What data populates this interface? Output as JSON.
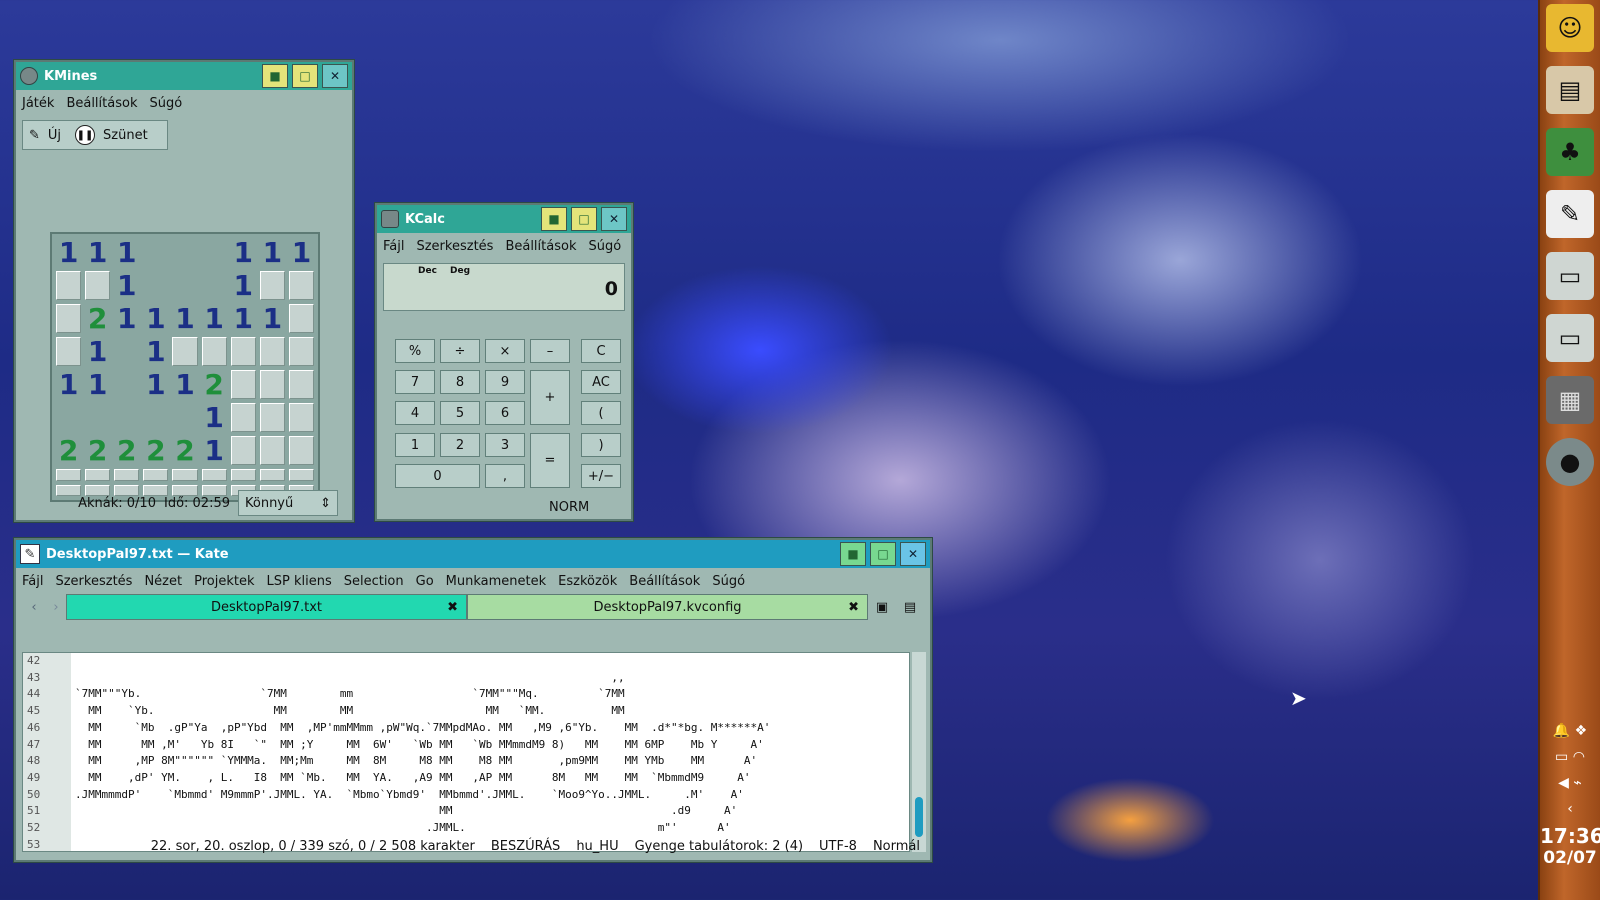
{
  "kmines": {
    "title": "KMines",
    "menu": [
      "Játék",
      "Beállítások",
      "Súgó"
    ],
    "new_label": "Új",
    "pause_label": "Szünet",
    "grid": [
      [
        "1",
        "1",
        "1",
        "",
        "",
        "",
        "1",
        "1",
        "1"
      ],
      [
        "#",
        "#",
        "1",
        "",
        "",
        "",
        "1",
        "#",
        "#"
      ],
      [
        "#",
        "2",
        "1",
        "1",
        "1",
        "1",
        "1",
        "1",
        "#"
      ],
      [
        "#",
        "1",
        "",
        "1",
        "#",
        "#",
        "#",
        "#",
        "#"
      ],
      [
        "1",
        "1",
        "",
        "1",
        "1",
        "2",
        "#",
        "#",
        "#"
      ],
      [
        "",
        "",
        "",
        "",
        "",
        "1",
        "#",
        "#",
        "#"
      ],
      [
        "2",
        "2",
        "2",
        "2",
        "2",
        "1",
        "#",
        "#",
        "#"
      ],
      [
        "#",
        "#",
        "#",
        "#",
        "#",
        "#",
        "#",
        "#",
        "#"
      ],
      [
        "#",
        "#",
        "#",
        "#",
        "#",
        "#",
        "#",
        "#",
        "#"
      ]
    ],
    "mines": "Aknák: 0/10",
    "time": "Idő: 02:59",
    "difficulty": "Könnyű"
  },
  "kcalc": {
    "title": "KCalc",
    "menu": [
      "Fájl",
      "Szerkesztés",
      "Beállítások",
      "Súgó"
    ],
    "dec": "Dec",
    "deg": "Deg",
    "display": "0",
    "mode": "NORM",
    "keys": {
      "pct": "%",
      "div": "÷",
      "mul": "×",
      "sub": "–",
      "clr": "C",
      "k7": "7",
      "k8": "8",
      "k9": "9",
      "add": "+",
      "ac": "AC",
      "k4": "4",
      "k5": "5",
      "k6": "6",
      "lp": "(",
      "k1": "1",
      "k2": "2",
      "k3": "3",
      "eq": "=",
      "rp": ")",
      "k0": "0",
      "dot": ",",
      "neg": "+/−"
    }
  },
  "kate": {
    "title": "DesktopPal97.txt — Kate",
    "menu": [
      "Fájl",
      "Szerkesztés",
      "Nézet",
      "Projektek",
      "LSP kliens",
      "Selection",
      "Go",
      "Munkamenetek",
      "Eszközök",
      "Beállítások",
      "Súgó"
    ],
    "tabs": [
      "DesktopPal97.txt",
      "DesktopPal97.kvconfig"
    ],
    "lines": [
      "42",
      "43",
      "44",
      "45",
      "46",
      "47",
      "48",
      "49",
      "50",
      "51",
      "52",
      "53"
    ],
    "code": [
      "",
      "                                                                                 ,,",
      "`7MM\"\"\"Yb.                  `7MM        mm                  `7MM\"\"\"Mq.         `7MM",
      "  MM    `Yb.                  MM        MM                    MM   `MM.          MM",
      "  MM     `Mb  .gP\"Ya  ,pP\"Ybd  MM  ,MP'mmMMmm ,pW\"Wq.`7MMpdMAo. MM   ,M9 ,6\"Yb.    MM  .d*\"*bg. M******A'",
      "  MM      MM ,M'   Yb 8I   `\"  MM ;Y     MM  6W'   `Wb MM   `Wb MMmmdM9 8)   MM    MM 6MP    Mb Y     A'",
      "  MM     ,MP 8M\"\"\"\"\"\" `YMMMa.  MM;Mm     MM  8M     M8 MM    M8 MM       ,pm9MM    MM YMb    MM      A'",
      "  MM    ,dP' YM.    , L.   I8  MM `Mb.   MM  YA.   ,A9 MM   ,AP MM      8M   MM    MM  `MbmmdM9     A'",
      ".JMMmmmdP'    `Mbmmd' M9mmmP'.JMML. YA.  `Mbmo`Ybmd9'  MMbmmd'.JMML.    `Moo9^Yo..JMML.     .M'    A'",
      "                                                       MM                                 .d9     A'",
      "                                                     .JMML.                             m\"'      A'",
      ""
    ],
    "status": {
      "pos": "22. sor, 20. oszlop, 0 / 339 szó, 0 / 2 508 karakter",
      "mode": "BESZÚRÁS",
      "lang": "hu_HU",
      "tabs": "Gyenge tabulátorok: 2 (4)",
      "enc": "UTF-8",
      "hl": "Normál"
    }
  },
  "tray": {
    "time": "17:36",
    "date": "02/07"
  }
}
